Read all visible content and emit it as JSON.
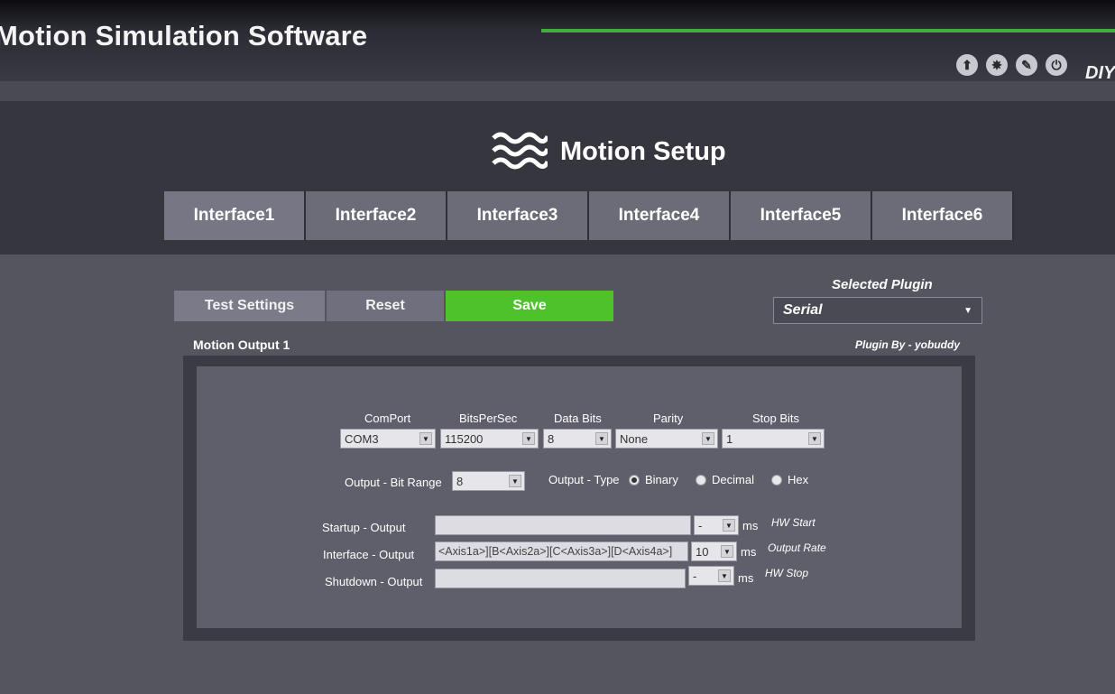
{
  "app": {
    "title": "Motion Simulation Software",
    "brand_partial": "DIY"
  },
  "top_icons": [
    "upload-icon",
    "sparkle-icon",
    "pencil-icon",
    "power-icon"
  ],
  "header": {
    "title": "Motion Setup",
    "icon": "waves-icon"
  },
  "tabs": [
    {
      "label": "Interface1"
    },
    {
      "label": "Interface2"
    },
    {
      "label": "Interface3"
    },
    {
      "label": "Interface4"
    },
    {
      "label": "Interface5"
    },
    {
      "label": "Interface6"
    }
  ],
  "actions": {
    "test_label": "Test Settings",
    "reset_label": "Reset",
    "save_label": "Save"
  },
  "plugin": {
    "label": "Selected Plugin",
    "value": "Serial",
    "by": "Plugin By - yobuddy"
  },
  "section": {
    "title": "Motion Output 1"
  },
  "serial": {
    "comport_label": "ComPort",
    "comport_value": "COM3",
    "bits_label": "BitsPerSec",
    "bits_value": "115200",
    "databits_label": "Data Bits",
    "databits_value": "8",
    "parity_label": "Parity",
    "parity_value": "None",
    "stopbits_label": "Stop Bits",
    "stopbits_value": "1"
  },
  "output": {
    "bitrange_label": "Output - Bit Range",
    "bitrange_value": "8",
    "type_label": "Output - Type",
    "selected_type": "Binary",
    "types": [
      "Binary",
      "Decimal",
      "Hex"
    ]
  },
  "rows": {
    "startup_label": "Startup - Output",
    "startup_value": "",
    "startup_ms": "-",
    "startup_hint": "HW Start",
    "interface_label": "Interface - Output",
    "interface_value": "<Axis1a>][B<Axis2a>][C<Axis3a>][D<Axis4a>]",
    "interface_ms": "10",
    "interface_hint": "Output Rate",
    "shutdown_label": "Shutdown - Output",
    "shutdown_value": "",
    "shutdown_ms": "-",
    "shutdown_hint": "HW Stop",
    "ms_unit": "ms"
  },
  "colors": {
    "accent_green": "#4ec22a",
    "title_bar_green": "#3fae3a"
  }
}
